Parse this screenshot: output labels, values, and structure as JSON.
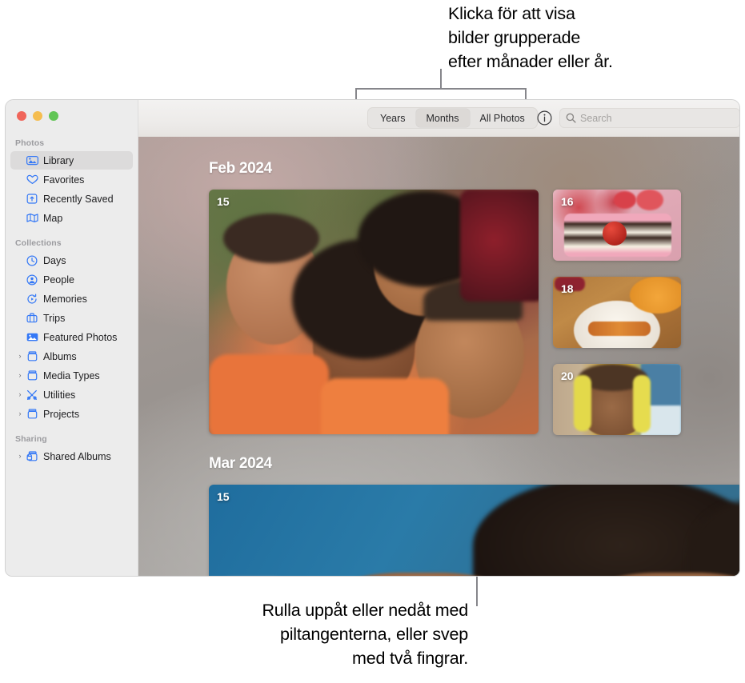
{
  "callouts": {
    "top": "Klicka för att visa\nbilder grupperade\nefter månader eller år.",
    "bottom": "Rulla uppåt eller nedåt med\npiltangenterna, eller svep\nmed två fingrar."
  },
  "window": {
    "traffic_lights": [
      "close-red",
      "minimize-yellow",
      "zoom-green"
    ]
  },
  "sidebar": {
    "sections": [
      {
        "title": "Photos",
        "items": [
          {
            "label": "Library",
            "icon": "library-icon",
            "selected": true,
            "expandable": false
          },
          {
            "label": "Favorites",
            "icon": "heart-icon",
            "selected": false,
            "expandable": false
          },
          {
            "label": "Recently Saved",
            "icon": "recently-saved-icon",
            "selected": false,
            "expandable": false
          },
          {
            "label": "Map",
            "icon": "map-icon",
            "selected": false,
            "expandable": false
          }
        ]
      },
      {
        "title": "Collections",
        "items": [
          {
            "label": "Days",
            "icon": "clock-icon",
            "selected": false,
            "expandable": false
          },
          {
            "label": "People",
            "icon": "person-circle-icon",
            "selected": false,
            "expandable": false
          },
          {
            "label": "Memories",
            "icon": "memories-icon",
            "selected": false,
            "expandable": false
          },
          {
            "label": "Trips",
            "icon": "suitcase-icon",
            "selected": false,
            "expandable": false
          },
          {
            "label": "Featured Photos",
            "icon": "photo-icon",
            "selected": false,
            "expandable": false
          },
          {
            "label": "Albums",
            "icon": "album-icon",
            "selected": false,
            "expandable": true
          },
          {
            "label": "Media Types",
            "icon": "album-icon",
            "selected": false,
            "expandable": true
          },
          {
            "label": "Utilities",
            "icon": "tools-icon",
            "selected": false,
            "expandable": true
          },
          {
            "label": "Projects",
            "icon": "album-icon",
            "selected": false,
            "expandable": true
          }
        ]
      },
      {
        "title": "Sharing",
        "items": [
          {
            "label": "Shared Albums",
            "icon": "shared-album-icon",
            "selected": false,
            "expandable": true
          }
        ]
      }
    ]
  },
  "toolbar": {
    "segments": [
      {
        "label": "Years",
        "active": false
      },
      {
        "label": "Months",
        "active": true
      },
      {
        "label": "All Photos",
        "active": false
      }
    ],
    "info_icon": "info-circle-icon",
    "search": {
      "icon": "search-icon",
      "placeholder": "Search",
      "value": ""
    }
  },
  "content": {
    "groups": [
      {
        "header": "Feb 2024",
        "photos": [
          {
            "day": "15",
            "name": "photo-group-selfie"
          },
          {
            "day": "16",
            "name": "photo-cake-slice"
          },
          {
            "day": "18",
            "name": "photo-carrots-plate"
          },
          {
            "day": "20",
            "name": "photo-beach-portrait"
          }
        ]
      },
      {
        "header": "Mar 2024",
        "photos": [
          {
            "day": "15",
            "name": "photo-blue-portrait"
          }
        ]
      }
    ]
  },
  "colors": {
    "accent_blue": "#3478f6",
    "selection_gray": "#dcdbdb",
    "sidebar_bg": "#ececec",
    "leader_line": "#86868b",
    "traffic_red": "#f0655a",
    "traffic_yellow": "#f5bd4f",
    "traffic_green": "#61c555"
  }
}
